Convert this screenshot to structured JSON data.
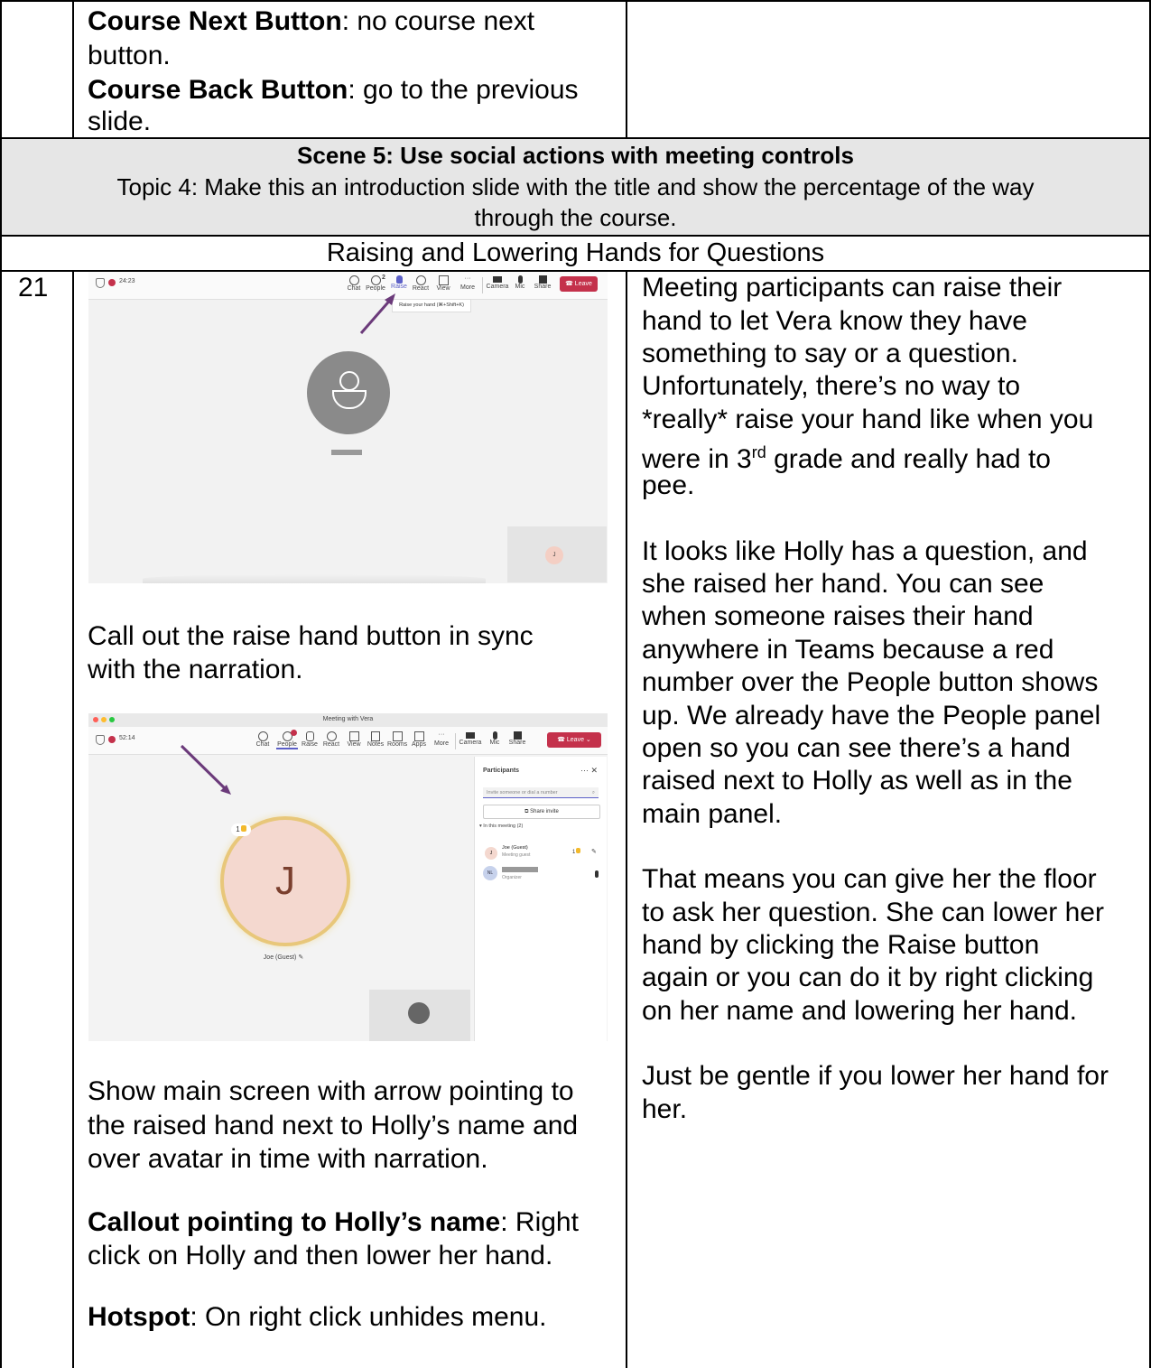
{
  "top_row": {
    "next_label": "Course Next Button",
    "next_text": ": no course next",
    "next_text2": "button.",
    "back_label": "Course Back Button",
    "back_text": ": go to the previous",
    "back_text2": "slide."
  },
  "scene": {
    "title": "Scene 5: Use social actions with meeting controls",
    "topic_line1": "Topic 4: Make this an introduction slide with the title and show the percentage of the way",
    "topic_line2": "through the course."
  },
  "section_title": "Raising and Lowering Hands for Questions",
  "row": {
    "number": "21",
    "screenshot1": {
      "timer": "24:23",
      "toolbar": [
        "Chat",
        "People",
        "Raise",
        "React",
        "View",
        "More",
        "Camera",
        "Mic",
        "Share"
      ],
      "people_count": "2",
      "leave": "Leave",
      "tooltip": "Raise your hand (⌘+Shift+K)",
      "tile_initial": "J"
    },
    "instr1": [
      "Call out the raise hand button in sync",
      "with the narration."
    ],
    "screenshot2": {
      "window_title": "Meeting with Vera",
      "timer": "52:14",
      "toolbar": [
        "Chat",
        "People",
        "Raise",
        "React",
        "View",
        "Notes",
        "Rooms",
        "Apps",
        "More",
        "Camera",
        "Mic",
        "Share"
      ],
      "leave": "Leave",
      "avatar_initial": "J",
      "hand_count": "1",
      "avatar_name": "Joe (Guest)",
      "panel_title": "Participants",
      "invite_placeholder": "Invite someone or dial a number",
      "share_invite": "Share invite",
      "in_meeting": "In this meeting (2)",
      "p1_name": "Joe (Guest)",
      "p1_role": "Meeting guest",
      "p1_initial": "J",
      "p2_initials": "NL",
      "p2_role": "Organizer"
    },
    "instr2": [
      "Show main screen with arrow pointing to",
      "the raised hand next to Holly’s name and",
      "over avatar in time with narration."
    ],
    "callout_label": "Callout pointing to Holly’s name",
    "callout_text": ": Right",
    "callout_text2": "click on Holly and then lower her hand.",
    "hotspot_label": "Hotspot",
    "hotspot_text": ": On right click unhides menu.",
    "narration_p1": [
      "Meeting participants can raise their",
      "hand to let Vera know they have",
      "something to say or a question.",
      "Unfortunately, there’s no way to",
      "*really* raise your hand like when you"
    ],
    "narration_p1_grade_pre": "were in 3",
    "narration_p1_grade_sup": "rd",
    "narration_p1_grade_post": " grade and really had to",
    "narration_p1_last": "pee.",
    "narration_p2": [
      "It looks like Holly has a question, and",
      "she raised her hand. You can see",
      "when someone raises their hand",
      "anywhere in Teams because a red",
      "number over the People button shows",
      "up. We already have the People panel",
      "open so you can see there’s a hand",
      "raised next to Holly as well as in the",
      "main panel."
    ],
    "narration_p3": [
      "That means you can give her the floor",
      "to ask her question. She can lower her",
      "hand by clicking the Raise button",
      "again or you can do it by right clicking",
      "on her name and lowering her hand."
    ],
    "narration_p4": [
      "Just be gentle if you lower her hand for",
      "her."
    ]
  },
  "colors": {
    "arrow": "#6b3a7a",
    "leave": "#c4314b",
    "accent": "#5b5fc7"
  }
}
